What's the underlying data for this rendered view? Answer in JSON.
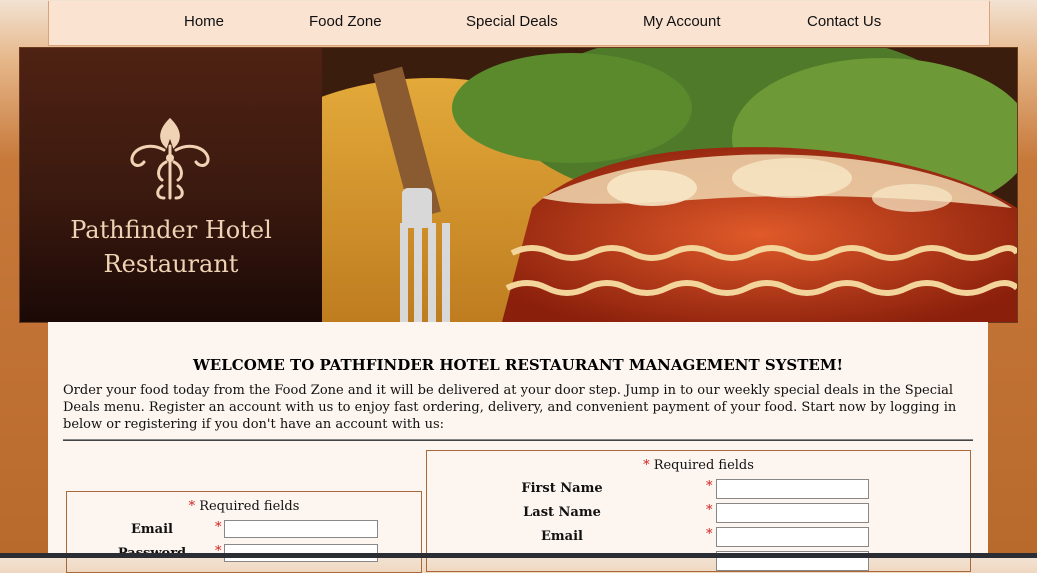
{
  "nav": {
    "items": [
      "Home",
      "Food Zone",
      "Special Deals",
      "My Account",
      "Contact Us"
    ]
  },
  "brand": {
    "name_line1": "Pathfinder Hotel",
    "name_line2": "Restaurant"
  },
  "main": {
    "welcome": "WELCOME TO PATHFINDER HOTEL RESTAURANT MANAGEMENT SYSTEM!",
    "intro": "Order your food today from the Food Zone and it will be delivered at your door step. Jump in to our weekly special deals in the Special Deals menu. Register an account with us to enjoy fast ordering, delivery, and convenient payment of your food. Start now by logging in below or registering if you don't have an account with us:"
  },
  "login": {
    "required_note": "Required fields",
    "required_marker": "*",
    "email_label": "Email",
    "password_label": "Password"
  },
  "register": {
    "required_note": "Required fields",
    "required_marker": "*",
    "first_name_label": "First Name",
    "last_name_label": "Last Name",
    "email_label": "Email"
  },
  "colors": {
    "accent": "#d12020",
    "nav_bg": "#fbe3d2",
    "content_bg": "#fdf5ef",
    "border": "#a86a3a"
  }
}
